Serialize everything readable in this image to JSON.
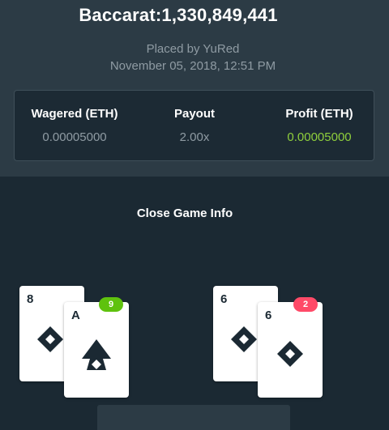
{
  "bet": {
    "title": "Baccarat:1,330,849,441",
    "placed_by": "Placed by YuRed",
    "date": "November 05, 2018, 12:51 PM"
  },
  "stats": {
    "wagered_label": "Wagered (ETH)",
    "wagered_value": "0.00005000",
    "payout_label": "Payout",
    "payout_value": "2.00x",
    "profit_label": "Profit (ETH)",
    "profit_value": "0.00005000"
  },
  "close_info_label": "Close Game Info",
  "hands": {
    "player": {
      "score": "9",
      "cards": [
        {
          "rank": "8",
          "suit": "spade-diamond-icon"
        },
        {
          "rank": "A",
          "suit": "spade-icon"
        }
      ]
    },
    "banker": {
      "score": "2",
      "cards": [
        {
          "rank": "6",
          "suit": "spade-diamond-icon"
        },
        {
          "rank": "6",
          "suit": "spade-diamond-icon"
        }
      ]
    }
  },
  "colors": {
    "background": "#1b2933",
    "panel": "#2c3b45",
    "profit": "#8fcf3c",
    "badge_win": "#5fc20e",
    "badge_lose": "#ff4a68"
  }
}
